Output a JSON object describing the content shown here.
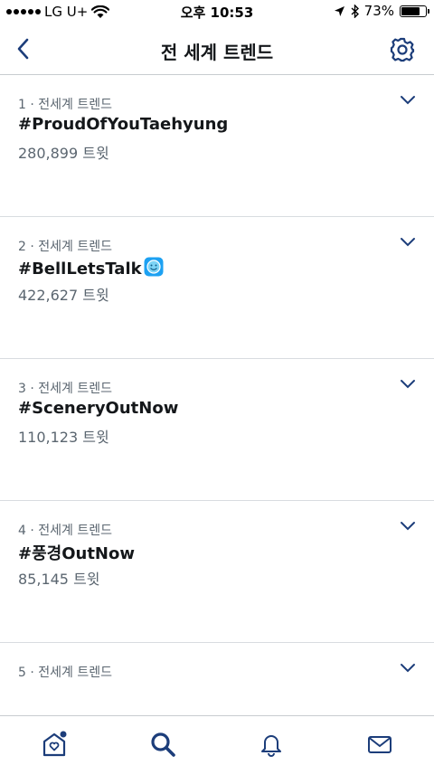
{
  "status_bar": {
    "carrier": "LG U+",
    "time": "오후 10:53",
    "battery": "73%",
    "battery_level": 0.73
  },
  "header": {
    "title": "전 세계 트렌드"
  },
  "trends": [
    {
      "meta": "1 · 전세계 트렌드",
      "name": "#ProudOfYouTaehyung",
      "count": "280,899 트윗"
    },
    {
      "meta": "2 · 전세계 트렌드",
      "name": "#BellLetsTalk",
      "count": "422,627 트윗",
      "emoji": "smile-emoji"
    },
    {
      "meta": "3 · 전세계 트렌드",
      "name": "#SceneryOutNow",
      "count": "110,123 트윗"
    },
    {
      "meta": "4 · 전세계 트렌드",
      "name": "#풍경OutNow",
      "count": "85,145 트윗"
    },
    {
      "meta": "5 · 전세계 트렌드",
      "name": "",
      "count": ""
    }
  ],
  "tab_bar": {
    "items": [
      "home-icon",
      "search-icon",
      "notifications-icon",
      "messages-icon"
    ],
    "active": "search-icon"
  },
  "colors": {
    "accent": "#1da1f2",
    "icon_blue": "#1c3d7a",
    "text_secondary": "#5b6670",
    "divider": "#d8dce0"
  }
}
